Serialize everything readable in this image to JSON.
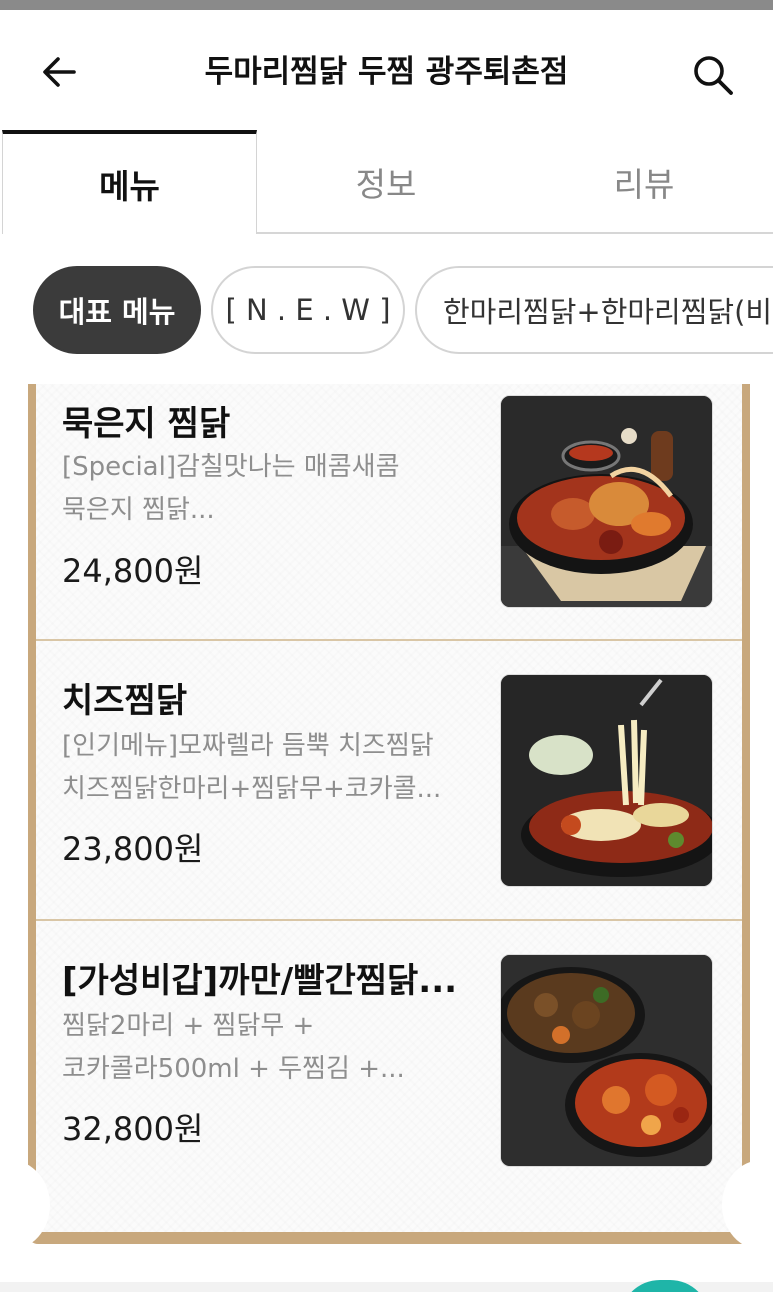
{
  "header": {
    "title": "두마리찜닭 두찜 광주퇴촌점",
    "back_icon": "arrow-left-icon",
    "search_icon": "search-icon"
  },
  "tabs": [
    {
      "label": "메뉴",
      "active": true
    },
    {
      "label": "정보",
      "active": false
    },
    {
      "label": "리뷰",
      "active": false
    }
  ],
  "chips": [
    {
      "label": "대표 메뉴",
      "active": true
    },
    {
      "label": "[ N . E . W ]",
      "active": false
    },
    {
      "label": "한마리찜닭+한마리찜닭(비조",
      "active": false
    }
  ],
  "menu": [
    {
      "name": "묵은지 찜닭",
      "desc_lines": [
        "[Special]감칠맛나는 매콤새콤",
        "묵은지 찜닭..."
      ],
      "price": "24,800원"
    },
    {
      "name": "치즈찜닭",
      "desc_lines": [
        "[인기메뉴]모짜렐라 듬뿍 치즈찜닭",
        "치즈찜닭한마리+찜닭무+코카콜..."
      ],
      "price": "23,800원"
    },
    {
      "name": "[가성비갑]까만/빨간찜닭...",
      "desc_lines": [
        "찜닭2마리 + 찜닭무 +",
        "코카콜라500ml + 두찜김 +..."
      ],
      "price": "32,800원"
    }
  ],
  "colors": {
    "accent_dark": "#3b3b3b",
    "frame_tan": "#c8a87d",
    "fab_teal": "#1fb5a8"
  }
}
